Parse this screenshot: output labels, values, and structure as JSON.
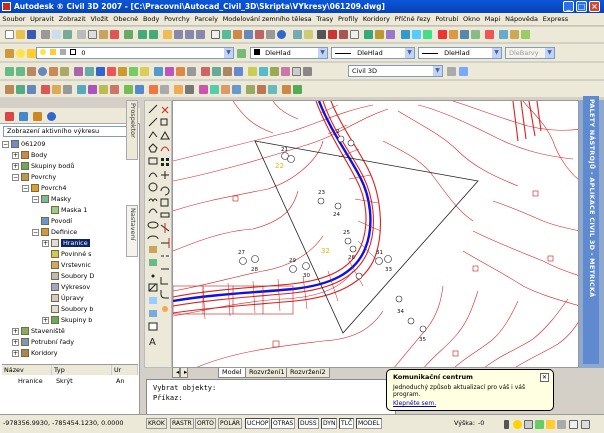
{
  "title": "Autodesk ® Civil 3D 2007 - [C:\\Pracovni\\Autocad_Civil_3D\\Skripta\\VYkresy\\061209.dwg]",
  "menu": [
    "Soubor",
    "Upravit",
    "Zobrazit",
    "Vložit",
    "Obecné",
    "Body",
    "Povrchy",
    "Parcely",
    "Modelování zemního tělesa",
    "Trasy",
    "Profily",
    "Koridory",
    "Příčné řezy",
    "Potrubí",
    "Okno",
    "Mapi",
    "Nápověda",
    "Express"
  ],
  "toolbar": {
    "layer_value": "0",
    "color_value": "DleHlad",
    "linetype_value": "DleHlad",
    "lineweight_value": "DleHlad",
    "plotstyle_value": "DleBarvy",
    "workspace_value": "Civil 3D"
  },
  "prospector": {
    "tab_label": "Prospektor",
    "settings_tab_label": "Nastavení",
    "view_combo": "Zobrazení aktivního výkresu",
    "tree": [
      {
        "label": "061209",
        "level": 0,
        "expander": "−",
        "icon": "drawing-icon"
      },
      {
        "label": "Body",
        "level": 1,
        "expander": "+",
        "icon": "points-icon"
      },
      {
        "label": "Skupiny bodů",
        "level": 1,
        "expander": "+",
        "icon": "point-groups-icon"
      },
      {
        "label": "Povrchy",
        "level": 1,
        "expander": "−",
        "icon": "surfaces-icon"
      },
      {
        "label": "Povrch4",
        "level": 2,
        "expander": "−",
        "icon": "surface-icon"
      },
      {
        "label": "Masky",
        "level": 3,
        "expander": "−",
        "icon": "masks-icon"
      },
      {
        "label": "Maska 1",
        "level": 4,
        "expander": "",
        "icon": "mask-icon"
      },
      {
        "label": "Povodí",
        "level": 3,
        "expander": "",
        "icon": "watershed-icon"
      },
      {
        "label": "Definice",
        "level": 3,
        "expander": "−",
        "icon": "definition-icon"
      },
      {
        "label": "Hranice",
        "level": 4,
        "expander": "+",
        "icon": "boundary-icon",
        "selected": true
      },
      {
        "label": "Povinné s",
        "level": 4,
        "expander": "",
        "icon": "breakline-icon"
      },
      {
        "label": "Vrstevnic",
        "level": 4,
        "expander": "",
        "icon": "contours-icon"
      },
      {
        "label": "Soubory D",
        "level": 4,
        "expander": "",
        "icon": "dem-files-icon"
      },
      {
        "label": "Výkresov",
        "level": 4,
        "expander": "",
        "icon": "drawing-objects-icon"
      },
      {
        "label": "Úpravy",
        "level": 4,
        "expander": "",
        "icon": "edits-icon"
      },
      {
        "label": "Soubory b",
        "level": 4,
        "expander": "",
        "icon": "point-files-icon"
      },
      {
        "label": "Skupiny b",
        "level": 4,
        "expander": "+",
        "icon": "point-groups-icon"
      },
      {
        "label": "Staveniště",
        "level": 1,
        "expander": "+",
        "icon": "sites-icon"
      },
      {
        "label": "Potrubní řady",
        "level": 1,
        "expander": "+",
        "icon": "pipe-networks-icon"
      },
      {
        "label": "Koridory",
        "level": 1,
        "expander": "+",
        "icon": "corridors-icon"
      }
    ],
    "props_headers": [
      "Název",
      "Typ",
      "Ur"
    ],
    "props_row": [
      "Hranice",
      "Skrýt",
      "An"
    ]
  },
  "layout_tabs": [
    "Model",
    "Rozvržení1",
    "Rozvržení2"
  ],
  "command": {
    "line1": "Vybrat objekty:",
    "line2": "Příkaz:"
  },
  "balloon": {
    "title": "Komunikační centrum",
    "text": "Jednoduchý způsob aktualizací pro váš i váš program.",
    "link": "Klepněte sem."
  },
  "palette_label": "PALETY NÁSTROJŮ - APLIKACE CIVIL 3D - METRICKÁ",
  "drawing_labels": [
    "21",
    "22",
    "23",
    "24",
    "25",
    "26",
    "27",
    "28",
    "29",
    "30",
    "31",
    "32",
    "33",
    "34",
    "35",
    "2"
  ],
  "status": {
    "coords": "-978356.9930, -785454.1230, 0.0000",
    "buttons": [
      "KROK",
      "RASTR",
      "ORTO",
      "POLÁR",
      "UCHOP",
      "OTRAS",
      "DUSS",
      "DYN",
      "TLČ",
      "MODEL"
    ],
    "scale_label": "Výška:",
    "scale_value": "-0"
  },
  "colors": {
    "title_bar": "#0842b4",
    "selection": "#0a246a",
    "balloon": "#ffffe1",
    "drawing_red": "#e02020",
    "alignment_blue": "#1010e0"
  }
}
